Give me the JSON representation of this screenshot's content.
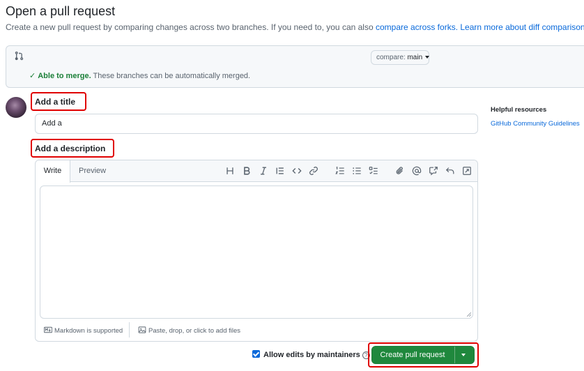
{
  "header": {
    "title": "Open a pull request",
    "subtitle_text": "Create a new pull request by comparing changes across two branches. If you need to, you can also",
    "compare_forks_link": "compare across forks.",
    "learn_more_link": "Learn more about diff comparisons here."
  },
  "range": {
    "compare_prefix": "compare:",
    "compare_branch": "main",
    "merge_status": "Able to merge.",
    "merge_detail": "These branches can be automatically merged."
  },
  "form": {
    "title_label": "Add a title",
    "title_value": "Add a",
    "description_label": "Add a description",
    "tabs": {
      "write": "Write",
      "preview": "Preview"
    },
    "footer_markdown": "Markdown is supported",
    "footer_files": "Paste, drop, or click to add files",
    "allow_edits_label": "Allow edits by maintainers",
    "allow_edits_checked": true,
    "create_button": "Create pull request",
    "toolbar_icons": [
      "heading-icon",
      "bold-icon",
      "italic-icon",
      "quote-icon",
      "code-icon",
      "link-icon",
      "ordered-list-icon",
      "unordered-list-icon",
      "task-list-icon",
      "attach-icon",
      "mention-icon",
      "reference-icon",
      "undo-icon",
      "fullscreen-icon"
    ]
  },
  "sidebar": {
    "heading": "Helpful resources",
    "link": "GitHub Community Guidelines"
  },
  "colors": {
    "accent_blue": "#0969da",
    "success_green": "#1a7f37",
    "primary_button": "#1f883d",
    "highlight_red": "#e00000"
  }
}
